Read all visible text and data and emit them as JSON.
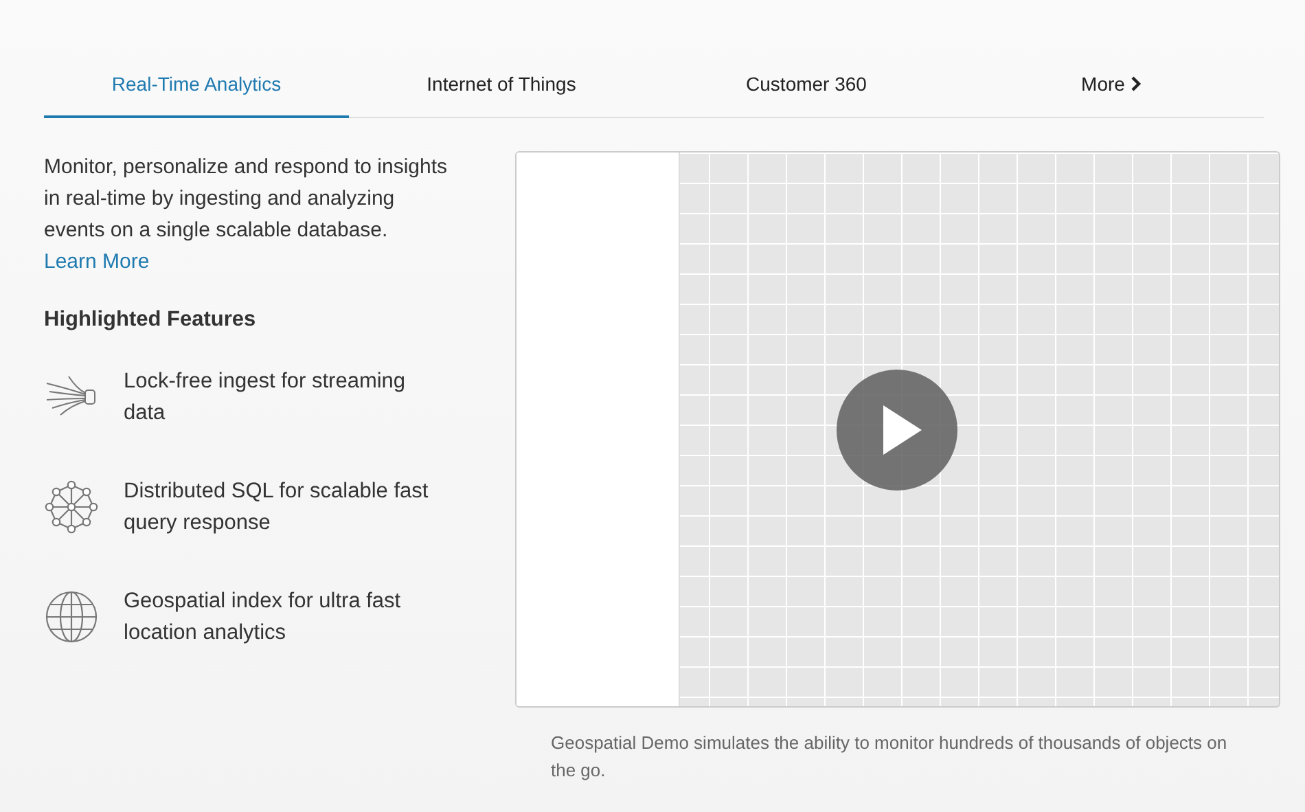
{
  "tabs": [
    {
      "label": "Real-Time Analytics",
      "selected": true,
      "chevron": false
    },
    {
      "label": "Internet of Things",
      "selected": false,
      "chevron": false
    },
    {
      "label": "Customer 360",
      "selected": false,
      "chevron": false
    },
    {
      "label": "More",
      "selected": false,
      "chevron": true
    }
  ],
  "intro": {
    "text": "Monitor, personalize and respond to insights in real-time by ingesting and analyzing events on a single scalable database.",
    "link": "Learn More"
  },
  "features_heading": "Highlighted Features",
  "features": [
    {
      "kind": "stream",
      "text": "Lock-free ingest for streaming data"
    },
    {
      "kind": "network",
      "text": "Distributed SQL for scalable fast query response"
    },
    {
      "kind": "globe",
      "text": "Geospatial index for ultra fast location analytics"
    }
  ],
  "video": {
    "caption": "Geospatial Demo simulates the ability to monitor hundreds of thousands of objects on the go."
  }
}
